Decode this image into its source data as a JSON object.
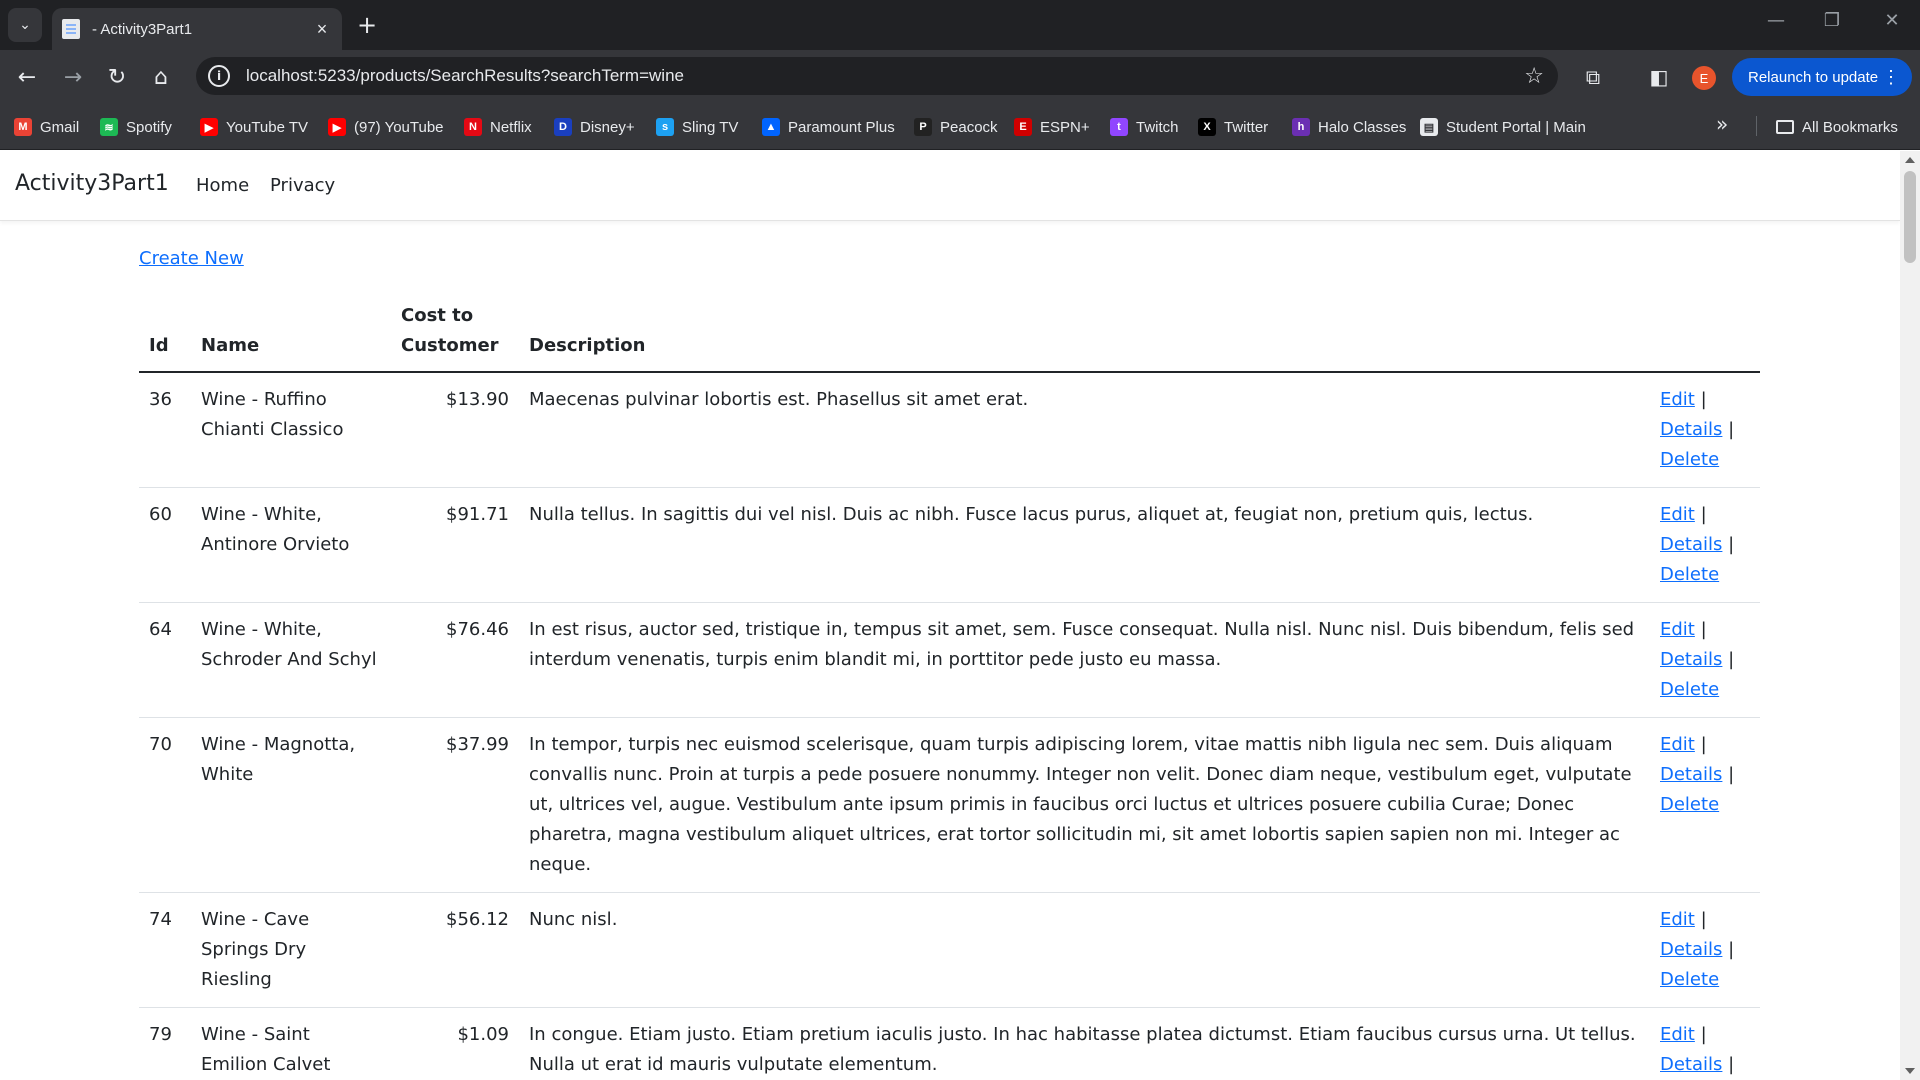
{
  "browser": {
    "tab_title": "- Activity3Part1",
    "url": "localhost:5233/products/SearchResults?searchTerm=wine",
    "relaunch_label": "Relaunch to update",
    "profile_initial": "E",
    "bookmarks": [
      {
        "label": "Gmail",
        "color": "#ea4335",
        "glyph": "M"
      },
      {
        "label": "Spotify",
        "color": "#1db954",
        "glyph": "≋"
      },
      {
        "label": "YouTube TV",
        "color": "#ff0000",
        "glyph": "▶"
      },
      {
        "label": "(97) YouTube",
        "color": "#ff0000",
        "glyph": "▶"
      },
      {
        "label": "Netflix",
        "color": "#e50914",
        "glyph": "N"
      },
      {
        "label": "Disney+",
        "color": "#1a3fbf",
        "glyph": "D"
      },
      {
        "label": "Sling TV",
        "color": "#1da1f2",
        "glyph": "s"
      },
      {
        "label": "Paramount Plus",
        "color": "#0064ff",
        "glyph": "▲"
      },
      {
        "label": "Peacock",
        "color": "#222222",
        "glyph": "P"
      },
      {
        "label": "ESPN+",
        "color": "#d00000",
        "glyph": "E"
      },
      {
        "label": "Twitch",
        "color": "#9146ff",
        "glyph": "t"
      },
      {
        "label": "Twitter",
        "color": "#000000",
        "glyph": "X"
      },
      {
        "label": "Halo Classes",
        "color": "#6b2fb3",
        "glyph": "h"
      },
      {
        "label": "Student Portal | Main",
        "color": "#e8eaed",
        "glyph": "▤"
      }
    ],
    "all_bookmarks_label": "All Bookmarks"
  },
  "page": {
    "brand": "Activity3Part1",
    "nav": [
      "Home",
      "Privacy"
    ],
    "create_new": "Create New",
    "headers": {
      "id": "Id",
      "name": "Name",
      "cost": "Cost to Customer",
      "description": "Description"
    },
    "actions": {
      "edit": "Edit",
      "details": "Details",
      "delete": "Delete",
      "separator": "|"
    },
    "rows": [
      {
        "id": "36",
        "name": "Wine - Ruffino Chianti Classico",
        "cost": "$13.90",
        "description": "Maecenas pulvinar lobortis est. Phasellus sit amet erat."
      },
      {
        "id": "60",
        "name": "Wine - White, Antinore Orvieto",
        "cost": "$91.71",
        "description": "Nulla tellus. In sagittis dui vel nisl. Duis ac nibh. Fusce lacus purus, aliquet at, feugiat non, pretium quis, lectus."
      },
      {
        "id": "64",
        "name": "Wine - White, Schroder And Schyl",
        "cost": "$76.46",
        "description": "In est risus, auctor sed, tristique in, tempus sit amet, sem. Fusce consequat. Nulla nisl. Nunc nisl. Duis bibendum, felis sed interdum venenatis, turpis enim blandit mi, in porttitor pede justo eu massa."
      },
      {
        "id": "70",
        "name": "Wine - Magnotta, White",
        "cost": "$37.99",
        "description": "In tempor, turpis nec euismod scelerisque, quam turpis adipiscing lorem, vitae mattis nibh ligula nec sem. Duis aliquam convallis nunc. Proin at turpis a pede posuere nonummy. Integer non velit. Donec diam neque, vestibulum eget, vulputate ut, ultrices vel, augue. Vestibulum ante ipsum primis in faucibus orci luctus et ultrices posuere cubilia Curae; Donec pharetra, magna vestibulum aliquet ultrices, erat tortor sollicitudin mi, sit amet lobortis sapien sapien non mi. Integer ac neque."
      },
      {
        "id": "74",
        "name": "Wine - Cave Springs Dry Riesling",
        "cost": "$56.12",
        "description": "Nunc nisl."
      },
      {
        "id": "79",
        "name": "Wine - Saint Emilion Calvet",
        "cost": "$1.09",
        "description": "In congue. Etiam justo. Etiam pretium iaculis justo. In hac habitasse platea dictumst. Etiam faucibus cursus urna. Ut tellus. Nulla ut erat id mauris vulputate elementum."
      }
    ]
  }
}
